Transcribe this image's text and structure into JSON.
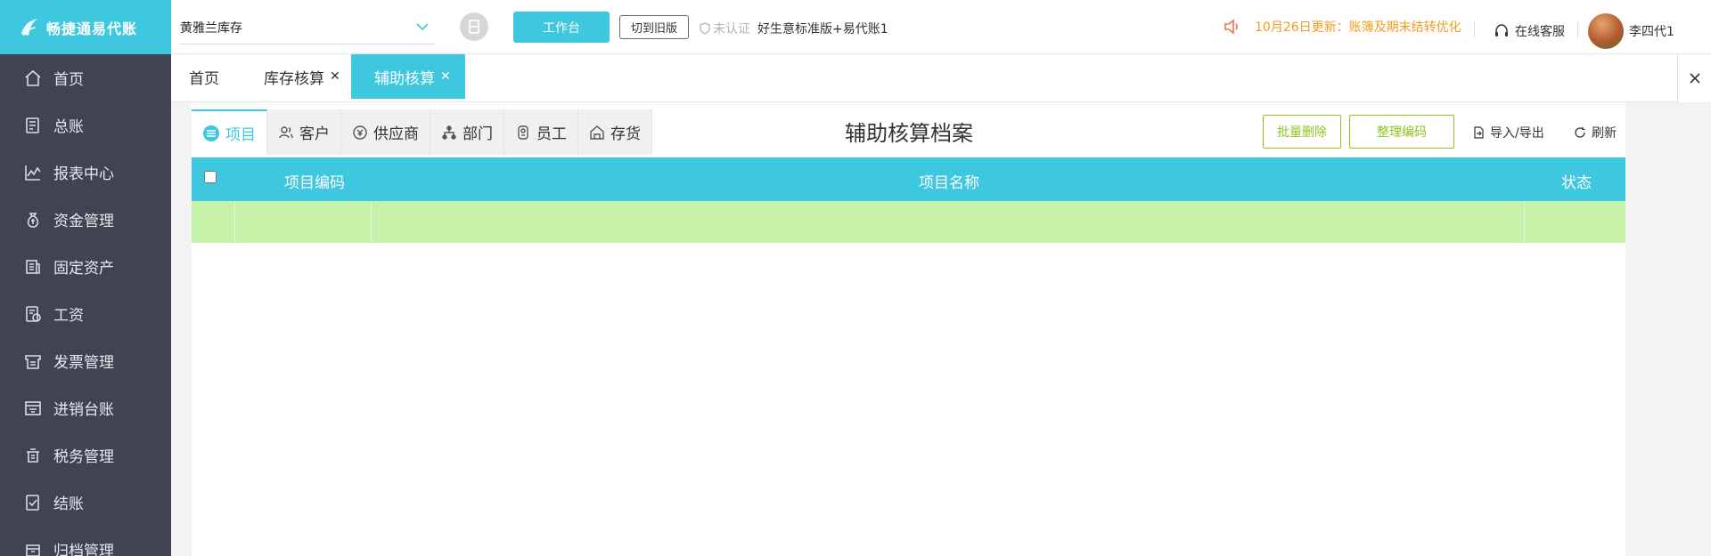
{
  "app": {
    "logo_text": "畅捷通易代账"
  },
  "sidebar": {
    "items": [
      {
        "label": "首页",
        "icon": "home-icon"
      },
      {
        "label": "总账",
        "icon": "ledger-icon"
      },
      {
        "label": "报表中心",
        "icon": "chart-icon"
      },
      {
        "label": "资金管理",
        "icon": "money-bag-icon"
      },
      {
        "label": "固定资产",
        "icon": "asset-icon"
      },
      {
        "label": "工资",
        "icon": "salary-icon"
      },
      {
        "label": "发票管理",
        "icon": "invoice-icon"
      },
      {
        "label": "进销台账",
        "icon": "inventory-icon"
      },
      {
        "label": "税务管理",
        "icon": "tax-icon"
      },
      {
        "label": "结账",
        "icon": "close-account-icon"
      },
      {
        "label": "归档管理",
        "icon": "archive-icon"
      }
    ]
  },
  "topbar": {
    "company": "黄雅兰库存",
    "workbench_label": "工作台",
    "old_version_label": "切到旧版",
    "unverified_label": "未认证",
    "version_label": "好生意标准版+易代账1",
    "notice": "10月26日更新：账簿及期末结转优化",
    "service_label": "在线客服",
    "user_name": "李四代1"
  },
  "tabs": [
    {
      "label": "首页",
      "closable": false,
      "active": false
    },
    {
      "label": "库存核算",
      "closable": true,
      "active": false
    },
    {
      "label": "辅助核算",
      "closable": true,
      "active": true
    }
  ],
  "content": {
    "title": "辅助核算档案",
    "subtabs": [
      {
        "label": "项目",
        "icon": "project-icon",
        "active": true
      },
      {
        "label": "客户",
        "icon": "customer-icon",
        "active": false
      },
      {
        "label": "供应商",
        "icon": "supplier-icon",
        "active": false
      },
      {
        "label": "部门",
        "icon": "department-icon",
        "active": false
      },
      {
        "label": "员工",
        "icon": "employee-icon",
        "active": false
      },
      {
        "label": "存货",
        "icon": "stock-icon",
        "active": false
      }
    ],
    "batch_delete_label": "批量删除",
    "organize_code_label": "整理编码",
    "import_export_label": "导入/导出",
    "refresh_label": "刷新",
    "table": {
      "columns": [
        "项目编码",
        "项目名称",
        "状态"
      ],
      "rows": [
        {
          "code": "",
          "name": "",
          "status": ""
        }
      ]
    }
  },
  "colors": {
    "accent": "#3ec8e0",
    "sidebar": "#404452",
    "highlight_row": "#c5f1a8",
    "outline_green": "#8fc31f",
    "notice": "#f39b1f"
  }
}
